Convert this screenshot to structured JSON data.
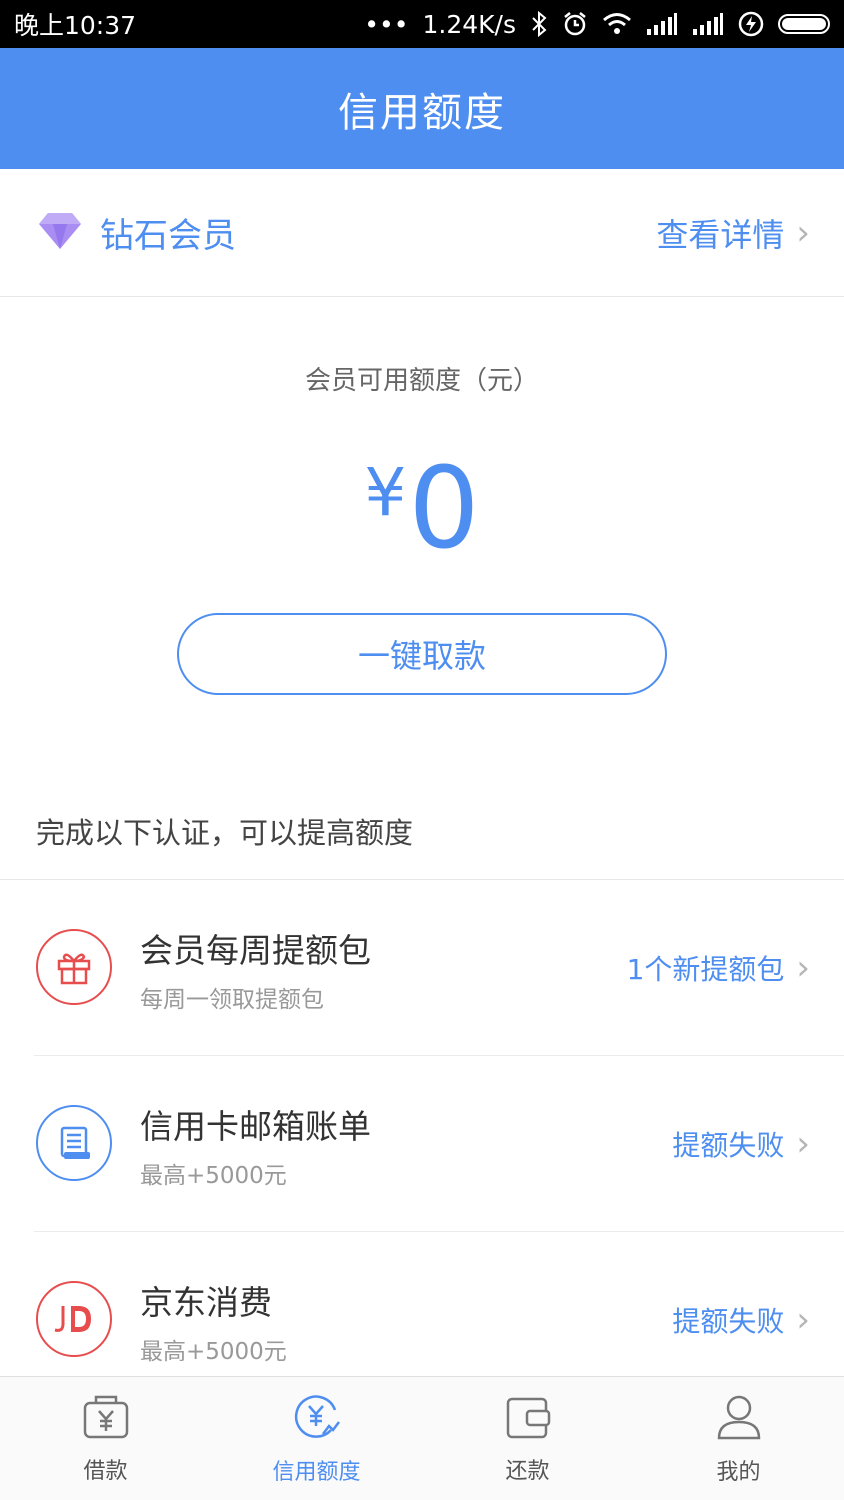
{
  "status_bar": {
    "time": "晚上10:37",
    "dots": "•••",
    "speed": "1.24K/s"
  },
  "header": {
    "title": "信用额度"
  },
  "member": {
    "title": "钻石会员",
    "detail_link": "查看详情",
    "chevron": "›"
  },
  "credit": {
    "label": "会员可用额度（元）",
    "currency": "¥",
    "amount": "0",
    "withdraw_button": "一键取款"
  },
  "hint": "完成以下认证，可以提高额度",
  "certifications": [
    {
      "title": "会员每周提额包",
      "subtitle": "每周一领取提额包",
      "action": "1个新提额包",
      "icon": "gift-icon",
      "color": "#e84d4d"
    },
    {
      "title": "信用卡邮箱账单",
      "subtitle": "最高+5000元",
      "action": "提额失败",
      "icon": "bill-icon",
      "color": "#4e8ef0"
    },
    {
      "title": "京东消费",
      "subtitle": "最高+5000元",
      "action": "提额失败",
      "icon": "jd-icon",
      "color": "#e84d4d"
    }
  ],
  "tabs": [
    {
      "label": "借款",
      "icon": "borrow-icon"
    },
    {
      "label": "信用额度",
      "icon": "credit-icon"
    },
    {
      "label": "还款",
      "icon": "wallet-icon"
    },
    {
      "label": "我的",
      "icon": "profile-icon"
    }
  ],
  "active_tab": "信用额度",
  "colors": {
    "accent": "#4e8ef0",
    "red": "#e84d4d",
    "diamond": "#a98df3"
  }
}
